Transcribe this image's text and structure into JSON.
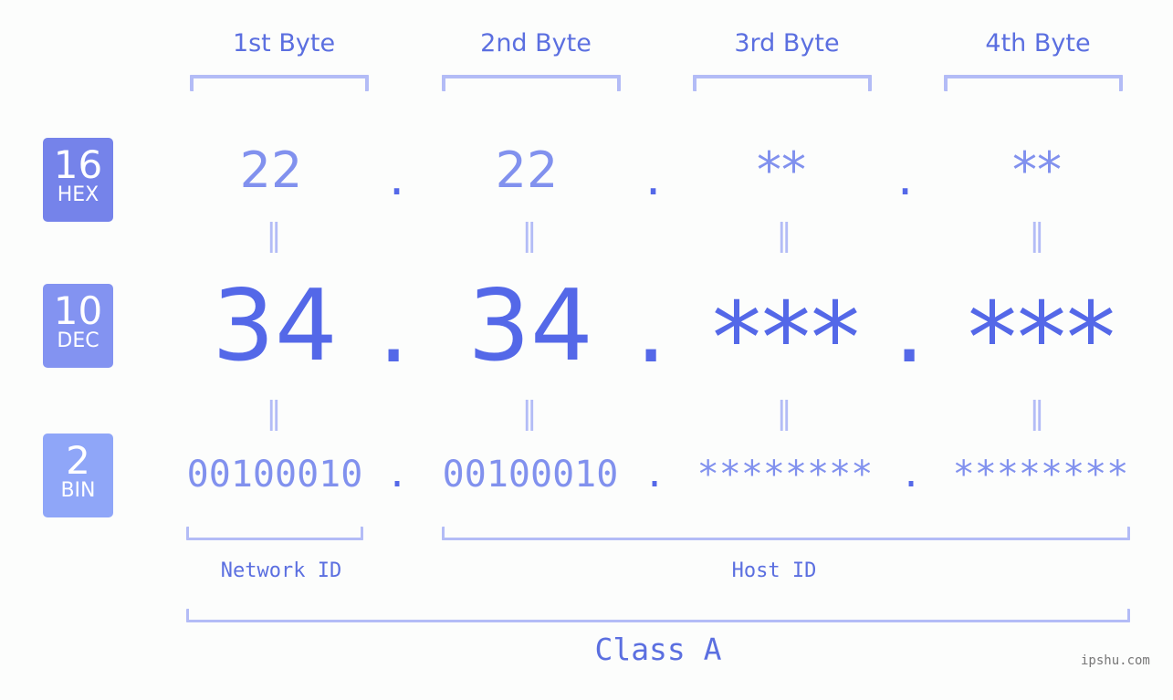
{
  "bytes": {
    "headers": [
      "1st Byte",
      "2nd Byte",
      "3rd Byte",
      "4th Byte"
    ]
  },
  "badges": {
    "hex": {
      "number": "16",
      "label": "HEX",
      "color": "#7583ea"
    },
    "dec": {
      "number": "10",
      "label": "DEC",
      "color": "#8393f1"
    },
    "bin": {
      "number": "2",
      "label": "BIN",
      "color": "#8fa6f8"
    }
  },
  "hex_values": [
    "22",
    "22",
    "**",
    "**"
  ],
  "dec_values": [
    "34",
    "34",
    "***",
    "***"
  ],
  "bin_values": [
    "00100010",
    "00100010",
    "********",
    "********"
  ],
  "separator": ".",
  "equals": "=",
  "labels": {
    "network_id": "Network ID",
    "host_id": "Host ID",
    "class": "Class A"
  },
  "watermark": "ipshu.com",
  "colors": {
    "primary": "#5468e8",
    "secondary": "#8191ee",
    "bracket": "#b3bcf6"
  }
}
